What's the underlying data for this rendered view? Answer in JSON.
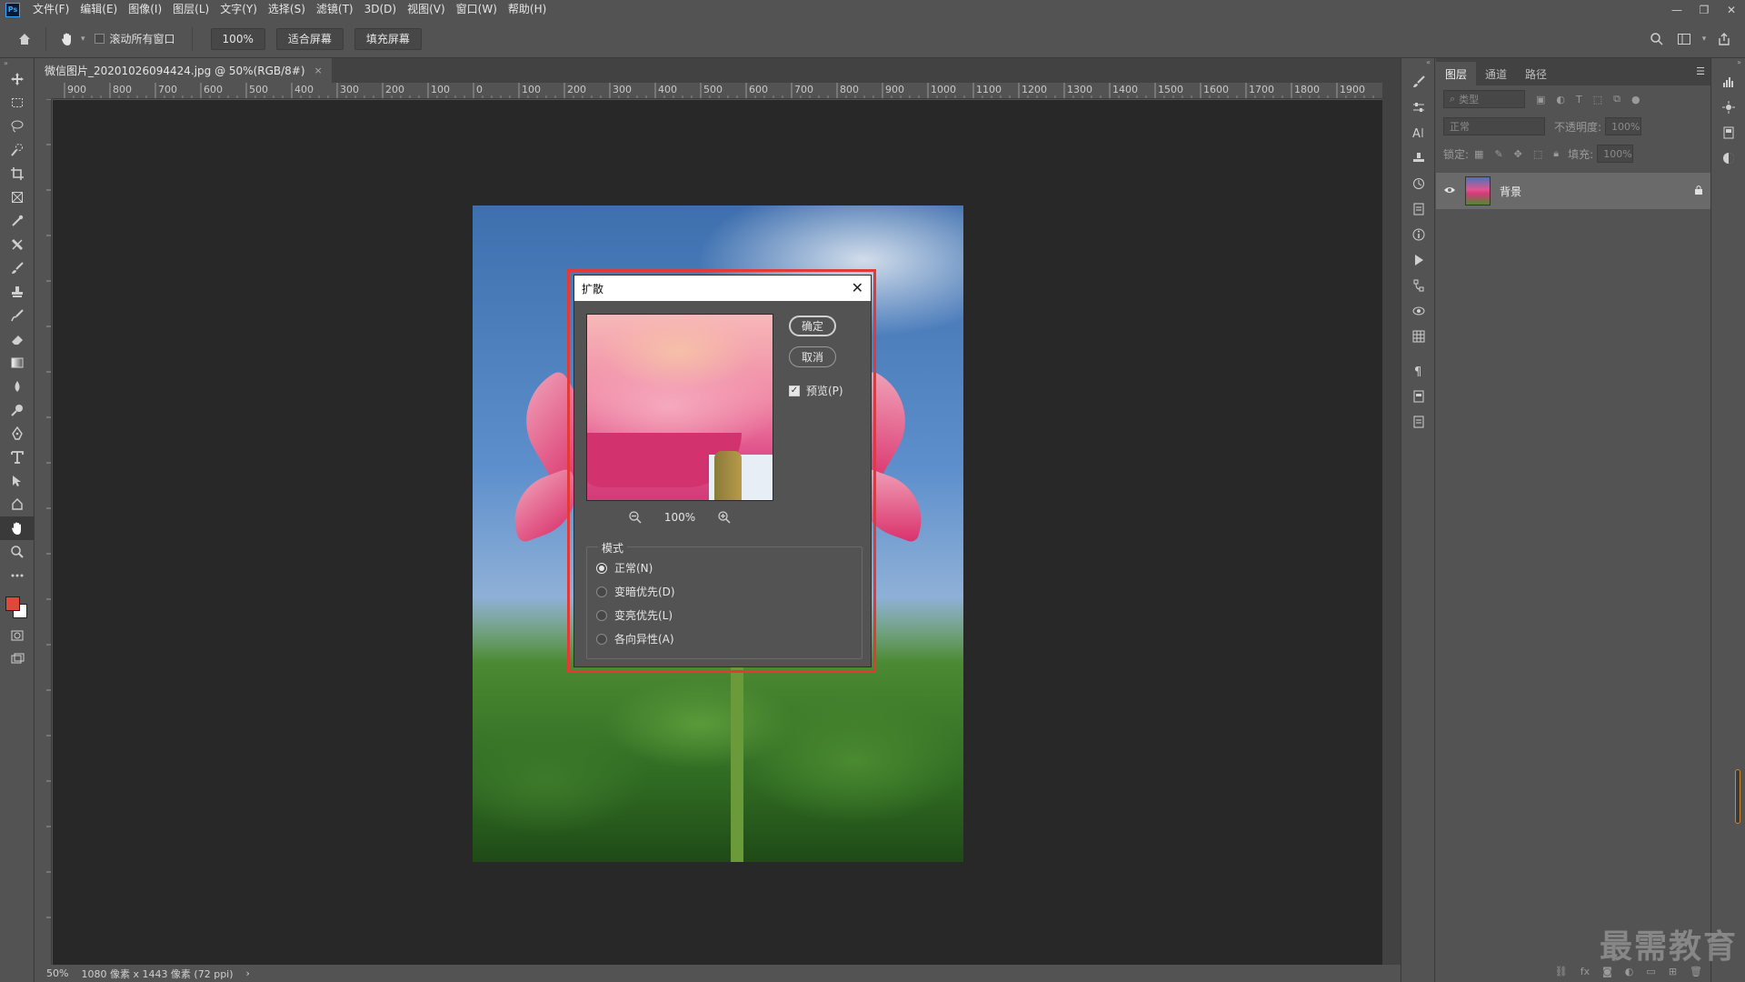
{
  "menubar": {
    "logo": "Ps",
    "items": [
      "文件(F)",
      "编辑(E)",
      "图像(I)",
      "图层(L)",
      "文字(Y)",
      "选择(S)",
      "滤镜(T)",
      "3D(D)",
      "视图(V)",
      "窗口(W)",
      "帮助(H)"
    ],
    "window_controls": [
      "minimize-icon",
      "restore-icon",
      "close-icon"
    ]
  },
  "optionsbar": {
    "scroll_all_windows_label": "滚动所有窗口",
    "zoom_value": "100%",
    "fit_screen_label": "适合屏幕",
    "fill_screen_label": "填充屏幕"
  },
  "document": {
    "tab_title": "微信图片_20201026094424.jpg @ 50%(RGB/8#)",
    "tab_close": "×",
    "ruler_h_ticks": [
      "900",
      "800",
      "700",
      "600",
      "500",
      "400",
      "300",
      "200",
      "100",
      "0",
      "100",
      "200",
      "300",
      "400",
      "500",
      "600",
      "700",
      "800",
      "900",
      "1000",
      "1100",
      "1200",
      "1300",
      "1400",
      "1500",
      "1600",
      "1700",
      "1800",
      "1900"
    ],
    "status_zoom": "50%",
    "status_info": "1080 像素 x 1443 像素 (72 ppi)",
    "status_arrow": "›"
  },
  "dialog": {
    "title": "扩散",
    "close": "✕",
    "ok_label": "确定",
    "cancel_label": "取消",
    "preview_label": "预览(P)",
    "preview_checked": true,
    "zoom_value": "100%",
    "mode_legend": "模式",
    "modes": [
      {
        "label": "正常(N)",
        "selected": true
      },
      {
        "label": "变暗优先(D)",
        "selected": false
      },
      {
        "label": "变亮优先(L)",
        "selected": false
      },
      {
        "label": "各向异性(A)",
        "selected": false
      }
    ]
  },
  "layers_panel": {
    "tabs": [
      "图层",
      "通道",
      "路径"
    ],
    "filter_placeholder": "类型",
    "blend_mode": "正常",
    "opacity_label": "不透明度:",
    "opacity_value": "100%",
    "lock_label": "锁定:",
    "fill_label": "填充:",
    "fill_value": "100%",
    "layers": [
      {
        "name": "背景",
        "locked": true,
        "visible": true
      }
    ]
  },
  "watermark": "最需教育",
  "colors": {
    "foreground": "#e0493a",
    "background": "#ffffff",
    "highlight": "#e53935"
  }
}
